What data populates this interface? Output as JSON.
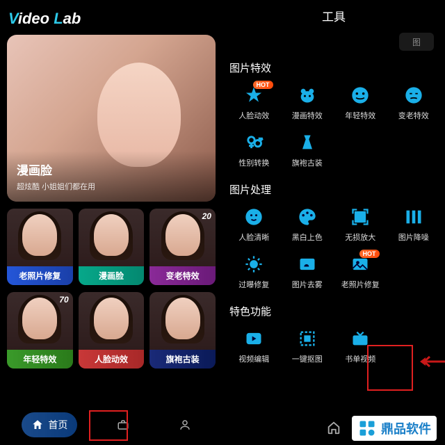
{
  "logo": {
    "v": "V",
    "ideo": "ideo ",
    "l": "L",
    "ab": "ab"
  },
  "hero": {
    "title": "漫画脸",
    "subtitle": "超炫酷 小姐姐们都在用"
  },
  "cards_row1": [
    {
      "label": "老照片修复",
      "badge": "",
      "cls": "lbl-blue"
    },
    {
      "label": "漫画脸",
      "badge": "",
      "cls": "lbl-teal"
    },
    {
      "label": "变老特效",
      "badge": "20",
      "cls": "lbl-purple"
    }
  ],
  "cards_row2": [
    {
      "label": "年轻特效",
      "badge": "70",
      "cls": "lbl-green"
    },
    {
      "label": "人脸动效",
      "badge": "",
      "cls": "lbl-red"
    },
    {
      "label": "旗袍古装",
      "badge": "",
      "cls": "lbl-navy"
    }
  ],
  "nav": {
    "home": "首页"
  },
  "tools": {
    "header": "工具",
    "search": "图",
    "hot": "HOT",
    "sections": [
      {
        "title": "图片特效",
        "items": [
          {
            "label": "人脸动效",
            "icon": "star",
            "hot": true
          },
          {
            "label": "漫画特效",
            "icon": "bear"
          },
          {
            "label": "年轻特效",
            "icon": "smile"
          },
          {
            "label": "变老特效",
            "icon": "oldface"
          },
          {
            "label": "性别转换",
            "icon": "gender"
          },
          {
            "label": "旗袍古装",
            "icon": "dress"
          }
        ]
      },
      {
        "title": "图片处理",
        "items": [
          {
            "label": "人脸清晰",
            "icon": "face"
          },
          {
            "label": "黑白上色",
            "icon": "palette"
          },
          {
            "label": "无损放大",
            "icon": "expand"
          },
          {
            "label": "图片降噪",
            "icon": "bars"
          },
          {
            "label": "过曝修复",
            "icon": "sun"
          },
          {
            "label": "图片去雾",
            "icon": "cloud"
          },
          {
            "label": "老照片修复",
            "icon": "photo",
            "hot": true
          }
        ]
      },
      {
        "title": "特色功能",
        "items": [
          {
            "label": "视频编辑",
            "icon": "play"
          },
          {
            "label": "一键抠图",
            "icon": "cutout"
          },
          {
            "label": "书单视频",
            "icon": "tv"
          }
        ]
      }
    ]
  },
  "watermark": "鼎品软件"
}
